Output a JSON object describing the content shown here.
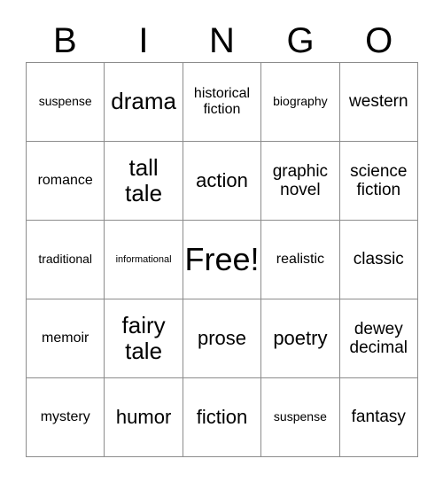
{
  "card": {
    "title": "BINGO",
    "header_letters": [
      "B",
      "I",
      "N",
      "G",
      "O"
    ],
    "columns": 5,
    "rows": 5,
    "border_color": "#8c8c8c",
    "background_color": "#ffffff",
    "text_color": "#000000",
    "free_space": {
      "row": 3,
      "column": 3,
      "label": "Free!"
    },
    "cells": [
      {
        "id": "r1c1",
        "text": "suspense",
        "size": "sm"
      },
      {
        "id": "r1c2",
        "text": "drama",
        "size": "xxl"
      },
      {
        "id": "r1c3",
        "text": "historical\nfiction",
        "size": "md"
      },
      {
        "id": "r1c4",
        "text": "biography",
        "size": "sm"
      },
      {
        "id": "r1c5",
        "text": "western",
        "size": "lg"
      },
      {
        "id": "r2c1",
        "text": "romance",
        "size": "md"
      },
      {
        "id": "r2c2",
        "text": "tall\ntale",
        "size": "xxl"
      },
      {
        "id": "r2c3",
        "text": "action",
        "size": "xl"
      },
      {
        "id": "r2c4",
        "text": "graphic\nnovel",
        "size": "lg"
      },
      {
        "id": "r2c5",
        "text": "science\nfiction",
        "size": "lg"
      },
      {
        "id": "r3c1",
        "text": "traditional",
        "size": "sm"
      },
      {
        "id": "r3c2",
        "text": "informational",
        "size": "xs"
      },
      {
        "id": "r3c3",
        "text": "Free!",
        "size": "free"
      },
      {
        "id": "r3c4",
        "text": "realistic",
        "size": "md"
      },
      {
        "id": "r3c5",
        "text": "classic",
        "size": "lg"
      },
      {
        "id": "r4c1",
        "text": "memoir",
        "size": "md"
      },
      {
        "id": "r4c2",
        "text": "fairy\ntale",
        "size": "xxl"
      },
      {
        "id": "r4c3",
        "text": "prose",
        "size": "xl"
      },
      {
        "id": "r4c4",
        "text": "poetry",
        "size": "xl"
      },
      {
        "id": "r4c5",
        "text": "dewey\ndecimal",
        "size": "lg"
      },
      {
        "id": "r5c1",
        "text": "mystery",
        "size": "md"
      },
      {
        "id": "r5c2",
        "text": "humor",
        "size": "xl"
      },
      {
        "id": "r5c3",
        "text": "fiction",
        "size": "xl"
      },
      {
        "id": "r5c4",
        "text": "suspense",
        "size": "sm"
      },
      {
        "id": "r5c5",
        "text": "fantasy",
        "size": "lg"
      }
    ]
  }
}
